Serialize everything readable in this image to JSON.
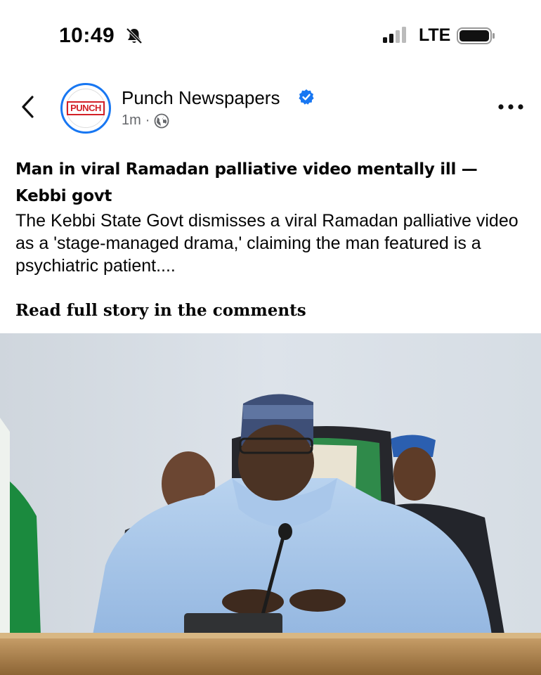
{
  "status_bar": {
    "time": "10:49",
    "network": "LTE",
    "icons": [
      "bell-muted-icon",
      "signal-icon",
      "battery-icon"
    ]
  },
  "post": {
    "page_name": "Punch Newspapers",
    "avatar_logo_text": "PUNCH",
    "time_ago": "1m",
    "separator": "·",
    "headline": "Man in viral Ramadan palliative video mentally ill — Kebbi govt",
    "summary": " The Kebbi State Govt dismisses a viral Ramadan palliative video as a 'stage-managed drama,' claiming the man featured is a psychiatric patient....",
    "read_more": "Read full story in the comments",
    "icons": [
      "back-chevron-icon",
      "verified-badge-icon",
      "globe-icon",
      "more-options-icon"
    ]
  },
  "colors": {
    "brand_blue": "#1877f2",
    "punch_red": "#d32027",
    "meta_gray": "#65676b"
  }
}
